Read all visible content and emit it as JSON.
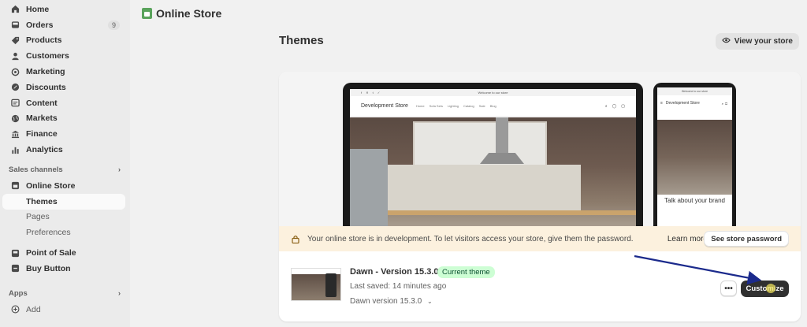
{
  "sidebar": {
    "items": [
      {
        "label": "Home",
        "icon": "home-icon"
      },
      {
        "label": "Orders",
        "icon": "inbox-icon",
        "badge": "9"
      },
      {
        "label": "Products",
        "icon": "tag-icon"
      },
      {
        "label": "Customers",
        "icon": "person-icon"
      },
      {
        "label": "Marketing",
        "icon": "target-icon"
      },
      {
        "label": "Discounts",
        "icon": "discount-icon"
      },
      {
        "label": "Content",
        "icon": "content-icon"
      },
      {
        "label": "Markets",
        "icon": "globe-icon"
      },
      {
        "label": "Finance",
        "icon": "bank-icon"
      },
      {
        "label": "Analytics",
        "icon": "chart-icon"
      }
    ],
    "sales_channels_label": "Sales channels",
    "online_store": "Online Store",
    "themes": "Themes",
    "pages": "Pages",
    "preferences": "Preferences",
    "point_of_sale": "Point of Sale",
    "buy_button": "Buy Button",
    "apps_label": "Apps",
    "add": "Add"
  },
  "header": {
    "section_title": "Online Store"
  },
  "page": {
    "title": "Themes",
    "view_store_label": "View your store"
  },
  "preview": {
    "desktop": {
      "announcement": "Welcome to our store",
      "brand": "Development Store",
      "menu": [
        "Home",
        "Sofa Sets",
        "Lighting",
        "Catalog",
        "Sale",
        "Blog"
      ]
    },
    "mobile": {
      "announcement": "Welcome to our store",
      "brand": "Development Store",
      "tagline": "Talk about your brand"
    }
  },
  "banner": {
    "text": "Your online store is in development. To let visitors access your store, give them the password.",
    "learn_more": "Learn more",
    "button": "See store password",
    "color": "#fcf1de"
  },
  "theme": {
    "name": "Dawn - Version 15.3.0",
    "badge": "Current theme",
    "last_saved": "Last saved: 14 minutes ago",
    "version": "Dawn version 15.3.0",
    "more_label": "•••",
    "customize_label": "Customize"
  },
  "colors": {
    "accent_dark": "#303030",
    "badge_green": "#cdfed4",
    "annotation_arrow": "#1b2a8c"
  }
}
